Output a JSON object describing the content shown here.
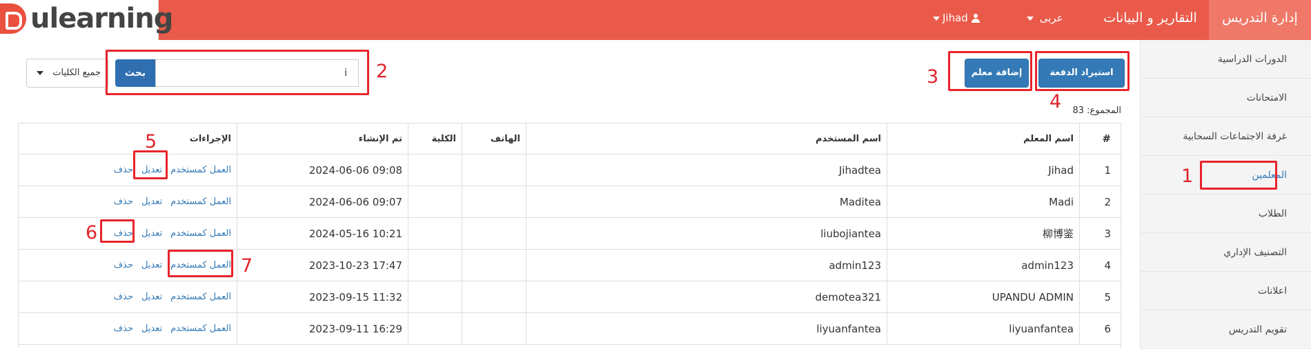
{
  "brand": {
    "logo_text": "ulearning"
  },
  "nav": {
    "teaching_admin": "إدارة التدريس",
    "reports": "التقارير و البيانات",
    "language": "عربى",
    "user": "Jihad"
  },
  "sidebar": {
    "items": [
      {
        "label": "الدورات الدراسية"
      },
      {
        "label": "الامتحانات"
      },
      {
        "label": "غرفة الاجتماعات السحابية"
      },
      {
        "label": "المعلمين"
      },
      {
        "label": "الطلاب"
      },
      {
        "label": "التصنيف الإداري"
      },
      {
        "label": "اعلانات"
      },
      {
        "label": "تقويم التدريس"
      }
    ]
  },
  "toolbar": {
    "college_select": "جميع الكليات",
    "search_button": "بحث",
    "search_value": "i",
    "add_teacher": "إضافة معلم",
    "batch_import": "استيراد الدفعة",
    "total": "المجموع: 83"
  },
  "table": {
    "headers": {
      "num": "#",
      "teacher_name": "اسم المعلم",
      "username": "اسم المستخدم",
      "phone": "الهاتف",
      "college": "الكلية",
      "created": "تم الإنشاء",
      "actions": "الإجراءات"
    },
    "action_labels": {
      "login_as": "العمل كمستخدم",
      "edit": "تعديل",
      "delete": "حذف"
    },
    "rows": [
      {
        "num": "1",
        "name": "Jihad",
        "username": "Jihadtea",
        "phone": "",
        "college": "",
        "created": "2024-06-06 09:08"
      },
      {
        "num": "2",
        "name": "Madi",
        "username": "Maditea",
        "phone": "",
        "college": "",
        "created": "2024-06-06 09:07"
      },
      {
        "num": "3",
        "name": "柳博鉴",
        "username": "liubojiantea",
        "phone": "",
        "college": "",
        "created": "2024-05-16 10:21"
      },
      {
        "num": "4",
        "name": "admin123",
        "username": "admin123",
        "phone": "",
        "college": "",
        "created": "2023-10-23 17:47"
      },
      {
        "num": "5",
        "name": "UPANDU ADMIN",
        "username": "demotea321",
        "phone": "",
        "college": "",
        "created": "2023-09-15 11:32"
      },
      {
        "num": "6",
        "name": "liyuanfantea",
        "username": "liyuanfantea",
        "phone": "",
        "college": "",
        "created": "2023-09-11 16:29"
      }
    ]
  },
  "annotations": [
    "1",
    "2",
    "3",
    "4",
    "5",
    "6",
    "7"
  ],
  "colors": {
    "topbar": "#ea5a4a",
    "primary_button": "#337ab7",
    "annotation": "#e8232b"
  }
}
